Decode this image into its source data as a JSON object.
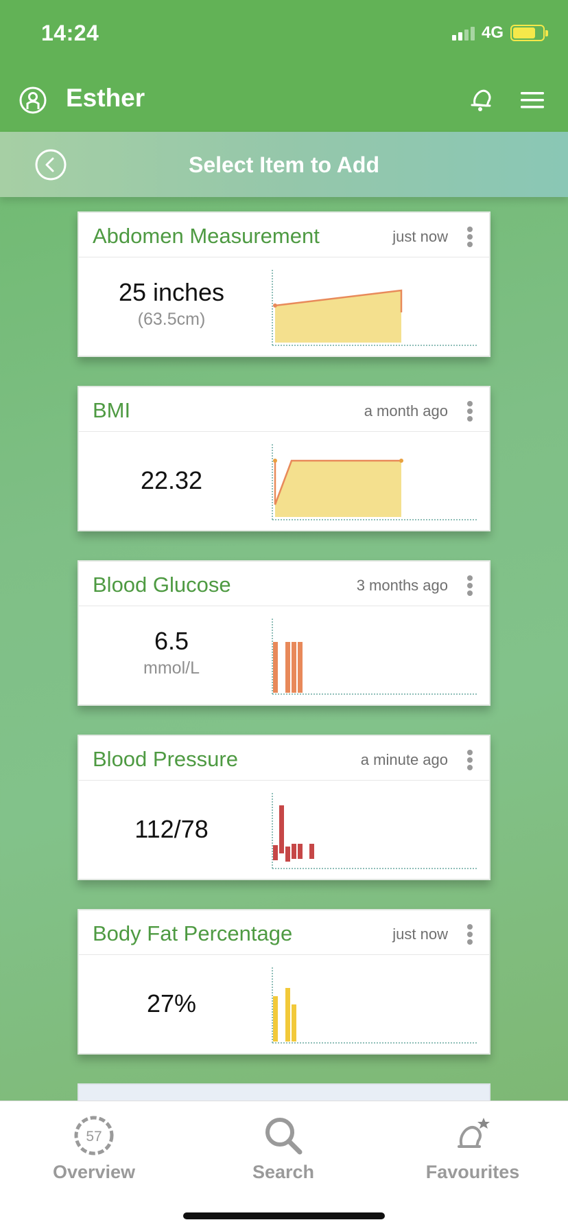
{
  "status_bar": {
    "time": "14:24",
    "network": "4G"
  },
  "header": {
    "user_name": "Esther"
  },
  "subheader": {
    "title": "Select Item to Add"
  },
  "cards": [
    {
      "title": "Abdomen Measurement",
      "time": "just now",
      "value": "25 inches",
      "sub": "(63.5cm)",
      "chart_type": "area",
      "color": "#f0dc8a",
      "line_color": "#e88a5a"
    },
    {
      "title": "BMI",
      "time": "a month ago",
      "value": "22.32",
      "sub": "",
      "chart_type": "area",
      "color": "#f0dc8a",
      "line_color": "#e88a5a"
    },
    {
      "title": "Blood Glucose",
      "time": "3 months ago",
      "value": "6.5",
      "sub": "mmol/L",
      "chart_type": "bar",
      "color": "#e8895a"
    },
    {
      "title": "Blood Pressure",
      "time": "a minute ago",
      "value": "112/78",
      "sub": "",
      "chart_type": "bar",
      "color": "#c64747"
    },
    {
      "title": "Body Fat Percentage",
      "time": "just now",
      "value": "27%",
      "sub": "",
      "chart_type": "bar",
      "color": "#f2c93a"
    }
  ],
  "tabs": [
    {
      "label": "Overview",
      "badge": "57"
    },
    {
      "label": "Search"
    },
    {
      "label": "Favourites"
    }
  ]
}
